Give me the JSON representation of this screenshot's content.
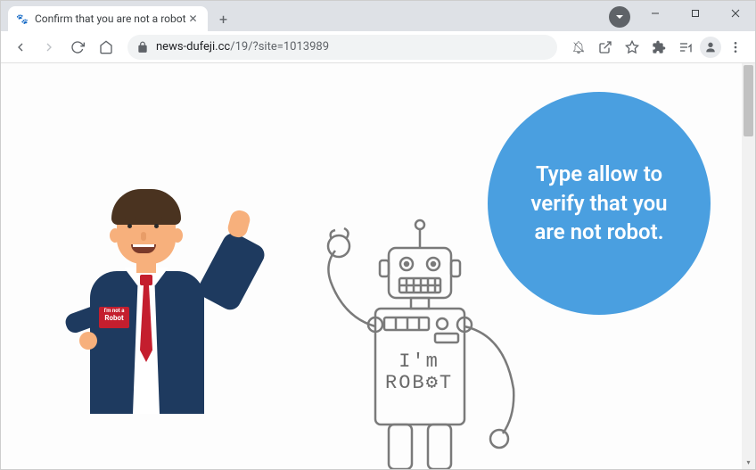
{
  "browser": {
    "tab_title": "Confirm that you are not a robot",
    "url_domain": "news-dufeji.cc",
    "url_path": "/19/?site=1013989"
  },
  "page": {
    "bubble_text": "Type allow to verify that you are not robot.",
    "badge_line1": "I'm not a",
    "badge_line2": "Robot",
    "robot_line1": "I'm",
    "robot_line2": "ROB⚙T"
  },
  "colors": {
    "bubble": "#4a9fe0",
    "suit": "#1e3a5f",
    "tie": "#c41e2e",
    "skin": "#f7b07c"
  }
}
